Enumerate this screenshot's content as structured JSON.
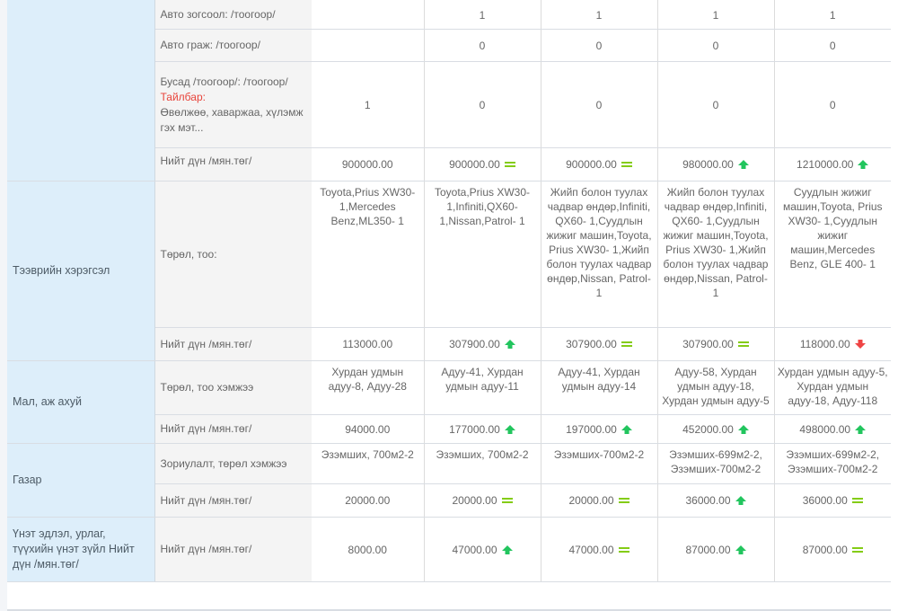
{
  "colors": {
    "category_bg": "#ddeefa",
    "label_bg": "#f4f4f4",
    "note_red": "#e8443b",
    "trend_up": "#22c55e",
    "trend_down": "#ef4444",
    "trend_equal": "#84cc16"
  },
  "rows": {
    "car_repair": {
      "label": "Авто зогсоол: /тоогоор/",
      "values": [
        "",
        "1",
        "1",
        "1",
        "1"
      ]
    },
    "garage": {
      "label": "Авто граж: /тоогоор/",
      "values": [
        "",
        "0",
        "0",
        "0",
        "0"
      ]
    },
    "other": {
      "label": "Бусад /тоогоор/: /тоогоор/",
      "note_label": "Тайлбар:",
      "note_text": "Өвөлжөө, хаваржаа, хүлэмж гэх мэт...",
      "values": [
        "1",
        "0",
        "0",
        "0",
        "0"
      ]
    },
    "realestate_total": {
      "label": "Нийт дүн /мян.төг/",
      "values": [
        "900000.00",
        "900000.00",
        "900000.00",
        "980000.00",
        "1210000.00"
      ],
      "trends": [
        "",
        "equal-icon",
        "equal-icon",
        "arrow-up-icon",
        "arrow-up-icon"
      ]
    },
    "vehicles_type": {
      "category": "Тээврийн хэрэгсэл",
      "label": "Төрөл, тоо:",
      "values": [
        "Toyota,Prius XW30-1,Mercedes Benz,ML350- 1",
        "Toyota,Prius XW30-1,Infiniti,QX60-1,Nissan,Patrol- 1",
        "Жийп болон туулах чадвар өндөр,Infiniti, QX60- 1,Суудлын жижиг машин,Toyota, Prius XW30- 1,Жийп болон туулах чадвар өндөр,Nissan, Patrol- 1",
        "Жийп болон туулах чадвар өндөр,Infiniti, QX60- 1,Суудлын жижиг машин,Toyota, Prius XW30- 1,Жийп болон туулах чадвар өндөр,Nissan, Patrol- 1",
        "Суудлын жижиг машин,Toyota, Prius XW30- 1,Суудлын жижиг машин,Mercedes Benz, GLE 400- 1"
      ]
    },
    "vehicles_total": {
      "label": "Нийт дүн /мян.төг/",
      "values": [
        "113000.00",
        "307900.00",
        "307900.00",
        "307900.00",
        "118000.00"
      ],
      "trends": [
        "",
        "arrow-up-icon",
        "equal-icon",
        "equal-icon",
        "arrow-down-icon"
      ]
    },
    "livestock_type": {
      "category": "Мал, аж ахуй",
      "label": "Төрөл, тоо хэмжээ",
      "values": [
        "Хурдан удмын адуу-8, Адуу-28",
        "Адуу-41, Хурдан удмын адуу-11",
        "Адуу-41, Хурдан удмын адуу-14",
        "Адуу-58, Хурдан удмын адуу-18, Хурдан удмын адуу-5",
        "Хурдан удмын адуу-5, Хурдан удмын адуу-18, Адуу-118"
      ]
    },
    "livestock_total": {
      "label": "Нийт дүн /мян.төг/",
      "values": [
        "94000.00",
        "177000.00",
        "197000.00",
        "452000.00",
        "498000.00"
      ],
      "trends": [
        "",
        "arrow-up-icon",
        "arrow-up-icon",
        "arrow-up-icon",
        "arrow-up-icon"
      ]
    },
    "land_type": {
      "category": "Газар",
      "label": "Зориулалт, төрөл хэмжээ",
      "values": [
        "Эзэмших, 700м2-2",
        "Эзэмших, 700м2-2",
        "Эзэмших-700м2-2",
        "Эзэмших-699м2-2, Эзэмших-700м2-2",
        "Эзэмших-699м2-2, Эзэмших-700м2-2"
      ]
    },
    "land_total": {
      "label": "Нийт дүн /мян.төг/",
      "values": [
        "20000.00",
        "20000.00",
        "20000.00",
        "36000.00",
        "36000.00"
      ],
      "trends": [
        "",
        "equal-icon",
        "equal-icon",
        "arrow-up-icon",
        "equal-icon"
      ]
    },
    "securities_total": {
      "category": "Үнэт эдлэл, урлаг, түүхийн үнэт зүйл Нийт дүн /мян.төг/",
      "label": "Нийт дүн /мян.төг/",
      "values": [
        "8000.00",
        "47000.00",
        "47000.00",
        "87000.00",
        "87000.00"
      ],
      "trends": [
        "",
        "arrow-up-icon",
        "equal-icon",
        "arrow-up-icon",
        "equal-icon"
      ]
    }
  }
}
